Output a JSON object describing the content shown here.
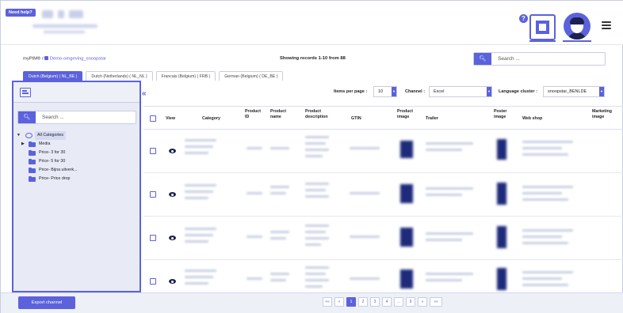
{
  "help": {
    "need_help": "Need help?"
  },
  "breadcrumb": {
    "root": "myPIM®",
    "sep": "/",
    "current": "Demo-omgeving_snoopstar"
  },
  "records": "Showing records 1-10 from 88",
  "search": {
    "placeholder": "Search ..."
  },
  "tabs": [
    {
      "label": "Dutch (Belgium) ( NL_BE )",
      "active": true
    },
    {
      "label": "Dutch (Netherlands) ( NL_NL )",
      "active": false
    },
    {
      "label": "Francais (Belgium) ( FRB )",
      "active": false
    },
    {
      "label": "German (Belgium) ( DE_BE )",
      "active": false
    }
  ],
  "sidebar": {
    "search_placeholder": "Search ...",
    "tree": {
      "root": "All Categories",
      "items": [
        {
          "label": "Media",
          "expandable": true
        },
        {
          "label": "Price- 3 for 30"
        },
        {
          "label": "Price- 5 for 30"
        },
        {
          "label": "Price- Bijna uitverk..."
        },
        {
          "label": "Price- Price drop"
        }
      ]
    },
    "export_button": "Export channel"
  },
  "filters": {
    "items_per_page_label": "Items per page :",
    "items_per_page_value": "10",
    "channel_label": "Channel :",
    "channel_value": "Excel",
    "language_cluster_label": "Language cluster :",
    "language_cluster_value": "snoopstar_BENLDE"
  },
  "table": {
    "headers": {
      "view": "View",
      "category": "Category",
      "product_id": "Product ID",
      "product_name": "Product name",
      "product_description": "Product description",
      "gtin": "GTIN",
      "product_image": "Product image",
      "trailer": "Trailer",
      "poster_image": "Poster image",
      "web_shop": "Web shop",
      "marketing_image": "Marketing image"
    }
  },
  "pagination": [
    "««",
    "«",
    "1",
    "2",
    "3",
    "4",
    "...",
    "9",
    "»",
    "»»"
  ],
  "pagination_active": "1",
  "colors": {
    "accent": "#5b62dc",
    "dark": "#1d2150"
  }
}
